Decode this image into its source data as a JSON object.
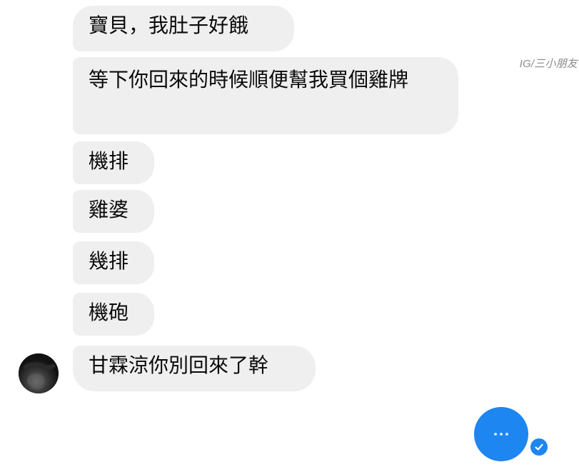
{
  "watermark": "IG/三小朋友",
  "messages": [
    {
      "text": "寶貝，我肚子好餓"
    },
    {
      "text": "等下你回來的時候順便幫我買個雞牌"
    },
    {
      "text": "機排"
    },
    {
      "text": "雞婆"
    },
    {
      "text": "幾排"
    },
    {
      "text": "機砲"
    },
    {
      "text": "甘霖涼你別回來了幹"
    }
  ],
  "icons": {
    "avatar": "user-avatar",
    "typing": "typing-indicator-icon",
    "seen": "seen-check-icon"
  },
  "colors": {
    "bubble_bg": "#efefef",
    "accent": "#1d86f0",
    "watermark_text": "#8a8a8a"
  }
}
